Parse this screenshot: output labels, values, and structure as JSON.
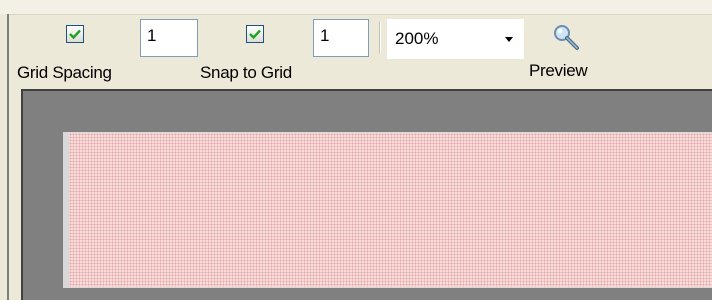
{
  "toolbar": {
    "grid_spacing": {
      "checked": true,
      "value": "1",
      "label": "Grid Spacing"
    },
    "snap_to_grid": {
      "checked": true,
      "value": "1",
      "label": "Snap to Grid"
    },
    "zoom": {
      "value": "200%",
      "icon": "dropdown-arrow-icon"
    },
    "preview": {
      "label": "Preview",
      "icon": "magnifier-icon"
    }
  },
  "canvas": {
    "page_color": "#f8dcdc",
    "dot_color": "#e6a8a8",
    "background_color": "#808080"
  }
}
